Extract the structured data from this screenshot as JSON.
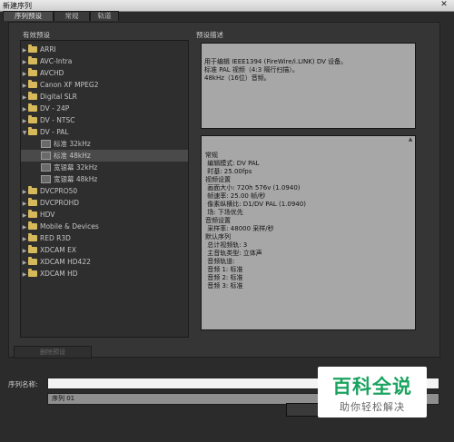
{
  "window": {
    "title": "新建序列",
    "close_glyph": "✕"
  },
  "tabs": [
    {
      "label": "序列预设",
      "active": true
    },
    {
      "label": "常规",
      "active": false
    },
    {
      "label": "轨道",
      "active": false
    }
  ],
  "presets_panel": {
    "label": "有效预设"
  },
  "tree": [
    {
      "label": "ARRI",
      "type": "folder",
      "expanded": false
    },
    {
      "label": "AVC-Intra",
      "type": "folder",
      "expanded": false
    },
    {
      "label": "AVCHD",
      "type": "folder",
      "expanded": false
    },
    {
      "label": "Canon XF MPEG2",
      "type": "folder",
      "expanded": false
    },
    {
      "label": "Digital SLR",
      "type": "folder",
      "expanded": false
    },
    {
      "label": "DV - 24P",
      "type": "folder",
      "expanded": false
    },
    {
      "label": "DV - NTSC",
      "type": "folder",
      "expanded": false
    },
    {
      "label": "DV - PAL",
      "type": "folder",
      "expanded": true
    },
    {
      "label": "标准 32kHz",
      "type": "file"
    },
    {
      "label": "标准 48kHz",
      "type": "file",
      "selected": true
    },
    {
      "label": "宽银幕 32kHz",
      "type": "file"
    },
    {
      "label": "宽银幕 48kHz",
      "type": "file"
    },
    {
      "label": "DVCPRO50",
      "type": "folder",
      "expanded": false
    },
    {
      "label": "DVCPROHD",
      "type": "folder",
      "expanded": false
    },
    {
      "label": "HDV",
      "type": "folder",
      "expanded": false
    },
    {
      "label": "Mobile & Devices",
      "type": "folder",
      "expanded": false
    },
    {
      "label": "RED R3D",
      "type": "folder",
      "expanded": false
    },
    {
      "label": "XDCAM EX",
      "type": "folder",
      "expanded": false
    },
    {
      "label": "XDCAM HD422",
      "type": "folder",
      "expanded": false
    },
    {
      "label": "XDCAM HD",
      "type": "folder",
      "expanded": false
    }
  ],
  "description_panel": {
    "label": "预设描述"
  },
  "description": [
    "用于编辑 IEEE1394 (FireWire/i.LINK) DV 设备。",
    "标准 PAL 视频（4:3 隔行扫描）。",
    "48kHz（16位）音频。"
  ],
  "details": [
    "常规",
    " 编辑模式: DV PAL",
    " 时基: 25.00fps",
    "",
    "视频设置",
    " 画面大小: 720h 576v (1.0940)",
    " 帧速率: 25.00 帧/秒",
    " 像素纵横比: D1/DV PAL (1.0940)",
    " 场: 下场优先",
    "",
    "音频设置",
    " 采样率: 48000 采样/秒",
    "",
    "默认序列",
    " 总计视频轨: 3",
    " 主音轨类型: 立体声",
    " 音频轨道:",
    " 音频 1: 标准",
    " 音频 2: 标准",
    " 音频 3: 标准"
  ],
  "buttons": {
    "delete_preset": "删除预设"
  },
  "sequence_name": {
    "label": "序列名称:",
    "value": ""
  },
  "autocomplete": {
    "value": "序列 01"
  },
  "watermark": {
    "main": "百科全说",
    "sub": "助你轻松解决"
  },
  "icons": {
    "folder": "folder-icon",
    "file": "preset-file-icon",
    "collapsed": "chevron-right-icon",
    "expanded": "chevron-down-icon"
  }
}
